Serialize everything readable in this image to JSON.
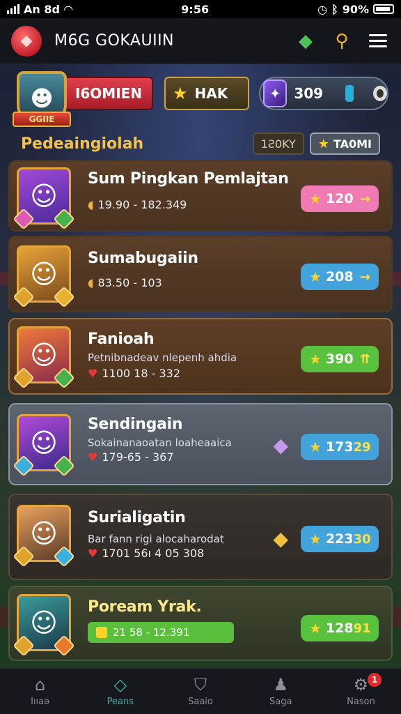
{
  "status_bar": {
    "carrier": "An 8d",
    "time": "9:56",
    "battery": "90%"
  },
  "header": {
    "title": "M6G GOKAUIIN",
    "icons": [
      "gem-icon",
      "search-icon",
      "menu-icon"
    ]
  },
  "resources": {
    "avatar_tag": "GGIIE",
    "red_label": "I6OMIEN",
    "gold_label": "HAK",
    "blue_value": "309"
  },
  "section": {
    "title": "Pedeaingiolah",
    "filter_a": "1Ƨ0KY",
    "filter_b": "TA0MI"
  },
  "rows": [
    {
      "title": "Sum Pingkan Pemlajtan",
      "subtitle": "",
      "meta": "19.90 - 182.349",
      "meta_icon": "coin",
      "button_value": "120",
      "button_extra": "→",
      "button_color": "pink"
    },
    {
      "title": "Sumabugaiin",
      "subtitle": "",
      "meta": "83.50 - 103",
      "meta_icon": "coin",
      "button_value": "208",
      "button_extra": "→",
      "button_color": "blue"
    },
    {
      "title": "Fanioah",
      "subtitle": "Petnibnadeav nlepenh ahdia",
      "meta": "1100 18 - 332",
      "meta_icon": "heart",
      "button_value": "390",
      "button_extra": "⇈",
      "button_color": "green"
    },
    {
      "title": "Sendingain",
      "subtitle": "Sokainanaoatan loaheaaica",
      "meta": "179-65 - 367",
      "meta_icon": "heart",
      "button_value": "173",
      "button_extra": "29",
      "button_color": "blue"
    },
    {
      "title": "Surialigatin",
      "subtitle": "Bar fann rigi alocaharodat",
      "meta": "1701 56ı 4 05 308",
      "meta_icon": "heart",
      "button_value": "223",
      "button_extra": "30",
      "button_color": "blue"
    },
    {
      "title": "Poream Yrak.",
      "subtitle": "",
      "meta": "21 58 - 12.391",
      "meta_icon": "square",
      "button_value": "128",
      "button_extra": "91",
      "button_color": "green"
    }
  ],
  "nav": [
    {
      "label": "Iııaə",
      "icon": "home-icon"
    },
    {
      "label": "Peans",
      "icon": "gem-icon"
    },
    {
      "label": "Saaio",
      "icon": "shield-icon"
    },
    {
      "label": "Saga",
      "icon": "user-icon"
    },
    {
      "label": "Nason",
      "icon": "settings-icon",
      "badge": "1"
    }
  ]
}
